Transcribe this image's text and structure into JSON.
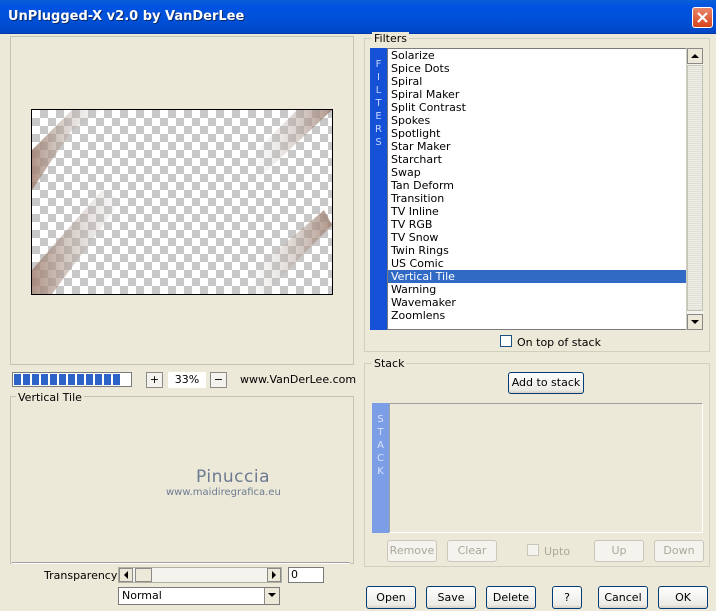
{
  "window": {
    "title": "UnPlugged-X v2.0 by VanDerLee"
  },
  "preview": {
    "zoom": "33%",
    "plus": "+",
    "minus": "−",
    "progress_blocks": 12
  },
  "site": "www.VanDerLee.com",
  "description": {
    "title": "Vertical Tile",
    "watermark_name": "Pinuccia",
    "watermark_url": "www.maidiregrafica.eu"
  },
  "transparency": {
    "label": "Transparency",
    "value": "0"
  },
  "blend_mode": {
    "value": "Normal"
  },
  "filters": {
    "group_label": "Filters",
    "sidebar_letters": [
      "F",
      "I",
      "L",
      "T",
      "E",
      "R",
      "S"
    ],
    "items": [
      "Solarize",
      "Spice Dots",
      "Spiral",
      "Spiral Maker",
      "Split Contrast",
      "Spokes",
      "Spotlight",
      "Star Maker",
      "Starchart",
      "Swap",
      "Tan Deform",
      "Transition",
      "TV Inline",
      "TV RGB",
      "TV Snow",
      "Twin Rings",
      "US Comic",
      "Vertical Tile",
      "Warning",
      "Wavemaker",
      "Zoomlens"
    ],
    "selected": "Vertical Tile",
    "on_top_label": "On top of stack"
  },
  "stack": {
    "group_label": "Stack",
    "add_label": "Add to stack",
    "sidebar_letters": [
      "S",
      "T",
      "A",
      "C",
      "K"
    ],
    "remove_label": "Remove",
    "clear_label": "Clear",
    "upto_label": "Upto",
    "up_label": "Up",
    "down_label": "Down"
  },
  "buttons": {
    "open": "Open",
    "save": "Save",
    "delete": "Delete",
    "help": "?",
    "cancel": "Cancel",
    "ok": "OK"
  },
  "colors": {
    "titlebar": "#0053e1",
    "selection": "#316ac5",
    "filters_bar": "#1451d6",
    "stack_bar": "#7b9ee6"
  }
}
